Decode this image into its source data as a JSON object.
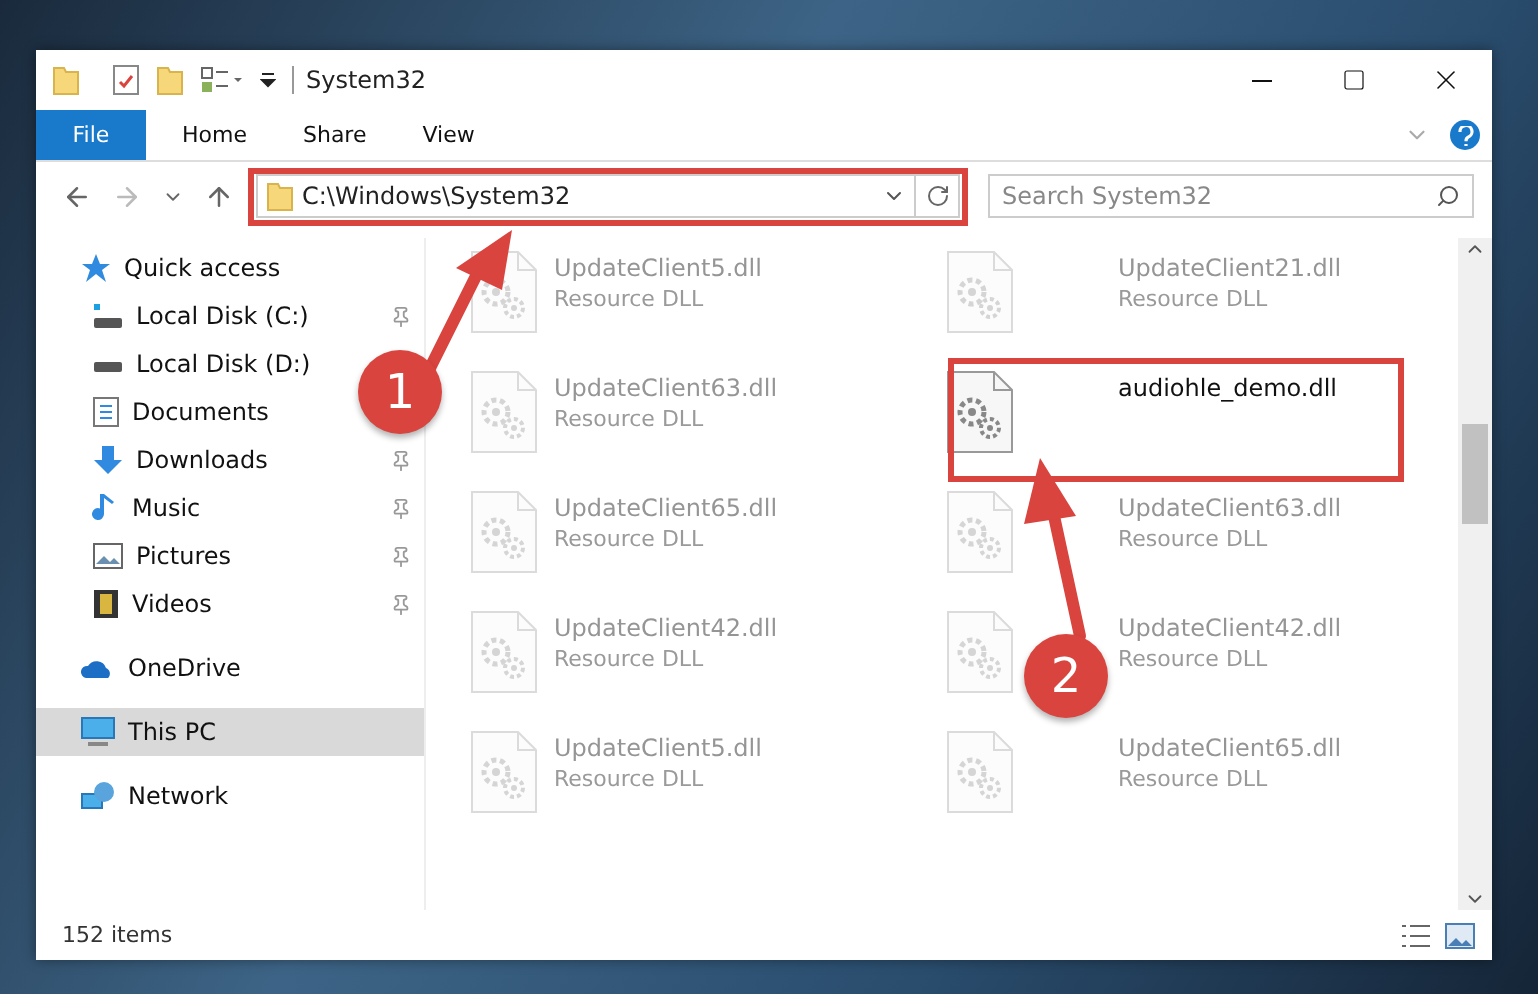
{
  "window": {
    "title": "System32"
  },
  "ribbon_tabs": [
    {
      "label": "File",
      "kind": "menu",
      "selected": false
    },
    {
      "label": "Home",
      "kind": "tab",
      "selected": false
    },
    {
      "label": "Share",
      "kind": "tab",
      "selected": false
    },
    {
      "label": "View",
      "kind": "tab",
      "selected": false
    }
  ],
  "address_bar": {
    "path": "C:\\Windows\\System32"
  },
  "search": {
    "placeholder": "Search System32"
  },
  "navigation": [
    {
      "label": "Quick access",
      "kind": "star",
      "selected": false,
      "children": [
        {
          "label": "Local Disk (C:)",
          "kind": "windisk",
          "pinned": true,
          "selected": false
        },
        {
          "label": "Local Disk (D:)",
          "kind": "disk",
          "pinned": false,
          "selected": false
        },
        {
          "label": "Documents",
          "kind": "document",
          "pinned": false,
          "selected": false
        },
        {
          "label": "Downloads",
          "kind": "download",
          "pinned": true,
          "selected": false
        },
        {
          "label": "Music",
          "kind": "music",
          "pinned": true,
          "selected": false
        },
        {
          "label": "Pictures",
          "kind": "picture",
          "pinned": true,
          "selected": false
        },
        {
          "label": "Videos",
          "kind": "video",
          "pinned": true,
          "selected": false
        }
      ]
    },
    {
      "label": "OneDrive",
      "kind": "cloud",
      "selected": false
    },
    {
      "label": "This PC",
      "kind": "pc",
      "selected": true
    },
    {
      "label": "Network",
      "kind": "network",
      "selected": false
    }
  ],
  "files": [
    {
      "name": "UpdateClient5.dll",
      "type": "Resource DLL",
      "blurred": true
    },
    {
      "name": "UpdateClient21.dll",
      "type": "Resource DLL",
      "blurred": true
    },
    {
      "name": "UpdateClient63.dll",
      "type": "Resource DLL",
      "blurred": true
    },
    {
      "name": "audiohle_demo.dll",
      "blurred": false
    },
    {
      "name": "UpdateClient65.dll",
      "type": "Resource DLL",
      "blurred": true
    },
    {
      "name": "UpdateClient63.dll",
      "type": "Resource DLL",
      "blurred": true
    },
    {
      "name": "UpdateClient42.dll",
      "type": "Resource DLL",
      "blurred": true
    },
    {
      "name": "UpdateClient42.dll",
      "type": "Resource DLL",
      "blurred": true
    },
    {
      "name": "UpdateClient5.dll",
      "type": "Resource DLL",
      "blurred": true
    },
    {
      "name": "UpdateClient65.dll",
      "type": "Resource DLL",
      "blurred": true
    }
  ],
  "status_bar": {
    "item_count": "152 items"
  },
  "annotations": [
    {
      "number": "1"
    },
    {
      "number": "2"
    }
  ]
}
